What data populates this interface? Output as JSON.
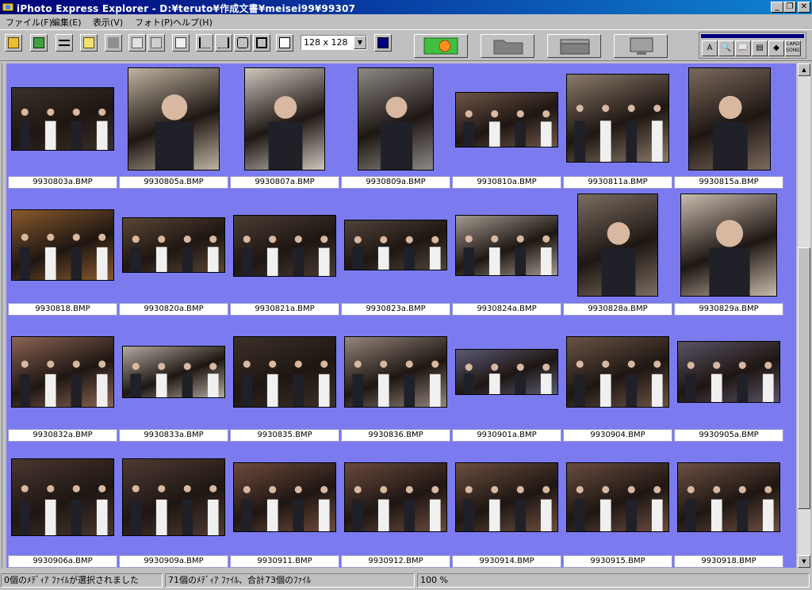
{
  "window": {
    "title": "iPhoto Express Explorer - D:¥teruto¥作成文書¥meisei99¥99307",
    "controls": [
      "_",
      "❐",
      "✕"
    ]
  },
  "menu": [
    "ファイル(F)",
    "編集(E)",
    "表示(V)",
    "フォト(P)",
    "ヘルプ(H)"
  ],
  "toolbar": {
    "zoom_value": "128 x 128",
    "zoom_arrow": "▼",
    "right_panel_labels": [
      "A",
      "🔍",
      "📖",
      "▤",
      "◆",
      "CARD SONG"
    ]
  },
  "thumbnails": [
    {
      "file": "9930803a.BMP",
      "color": "#3a3028"
    },
    {
      "file": "9930805a.BMP",
      "color": "#bfb4a2"
    },
    {
      "file": "9930807a.BMP",
      "color": "#cdc7bd"
    },
    {
      "file": "9930809a.BMP",
      "color": "#8f8a86"
    },
    {
      "file": "9930810a.BMP",
      "color": "#6e5548"
    },
    {
      "file": "9930811a.BMP",
      "color": "#8a7a6a"
    },
    {
      "file": "9930815a.BMP",
      "color": "#7b6a5e"
    },
    {
      "file": "9930818.BMP",
      "color": "#8a5a2c"
    },
    {
      "file": "9930820a.BMP",
      "color": "#5a4634"
    },
    {
      "file": "9930821a.BMP",
      "color": "#4a3c34"
    },
    {
      "file": "9930823a.BMP",
      "color": "#50443a"
    },
    {
      "file": "9930824a.BMP",
      "color": "#a49a90"
    },
    {
      "file": "9930828a.BMP",
      "color": "#7a6e62"
    },
    {
      "file": "9930829a.BMP",
      "color": "#c8bcae"
    },
    {
      "file": "9930832a.BMP",
      "color": "#8c6454"
    },
    {
      "file": "9930833a.BMP",
      "color": "#b4aca2"
    },
    {
      "file": "9930835.BMP",
      "color": "#3c3028"
    },
    {
      "file": "9930836.BMP",
      "color": "#94867a"
    },
    {
      "file": "9930901a.BMP",
      "color": "#5a5a74"
    },
    {
      "file": "9930904.BMP",
      "color": "#6a5446"
    },
    {
      "file": "9930905a.BMP",
      "color": "#5a5264"
    },
    {
      "file": "9930906a.BMP",
      "color": "#4a3630"
    },
    {
      "file": "9930909a.BMP",
      "color": "#503a34"
    },
    {
      "file": "9930911.BMP",
      "color": "#6e4a3c"
    },
    {
      "file": "9930912.BMP",
      "color": "#6a4a3e"
    },
    {
      "file": "9930914.BMP",
      "color": "#6c4e40"
    },
    {
      "file": "9930915.BMP",
      "color": "#6a4c40"
    },
    {
      "file": "9930918.BMP",
      "color": "#6c5044"
    }
  ],
  "scrollbar": {
    "up": "▲",
    "down": "▼"
  },
  "status": {
    "selected": "0個のﾒﾃﾞｨｱ ﾌｧｲﾙが選択されました",
    "total": "71個のﾒﾃﾞｨｱ ﾌｧｲﾙ、合計73個のﾌｧｲﾙ",
    "zoom": "100 %"
  }
}
